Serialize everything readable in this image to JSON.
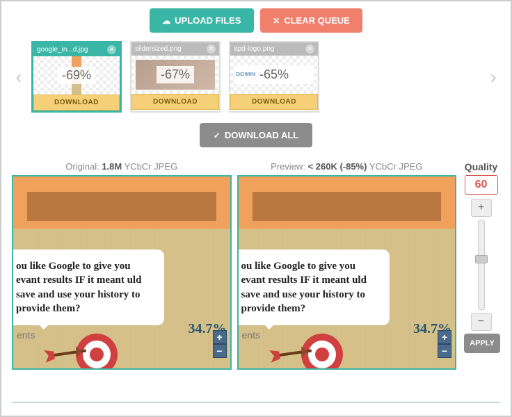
{
  "buttons": {
    "upload": "UPLOAD FILES",
    "clear": "CLEAR QUEUE",
    "download_all": "DOWNLOAD ALL",
    "download": "DOWNLOAD",
    "apply": "APPLY"
  },
  "thumbs": [
    {
      "name": "google_in...d.jpg",
      "percent": "-69%"
    },
    {
      "name": "slidersized.png",
      "percent": "-67%"
    },
    {
      "name": "apd-logo.png",
      "percent": "-65%"
    }
  ],
  "compare": {
    "original_prefix": "Original: ",
    "original_size": "1.8M",
    "original_suffix": " YCbCr JPEG",
    "preview_prefix": "Preview: ",
    "preview_size": "< 260K (-85%)",
    "preview_suffix": " YCbCr JPEG",
    "bubble_text": "ou like Google to give you evant results IF it meant uld save and use your history to provide them?",
    "value": "34.7%",
    "ents": "ents"
  },
  "quality": {
    "label": "Quality",
    "value": "60"
  },
  "icons": {
    "cloud": "☁",
    "x": "✕",
    "check": "✓",
    "plus": "+",
    "minus": "−",
    "left": "‹",
    "right": "›"
  },
  "thumb_content": {
    "apd_logo": "DIGIMINER"
  }
}
